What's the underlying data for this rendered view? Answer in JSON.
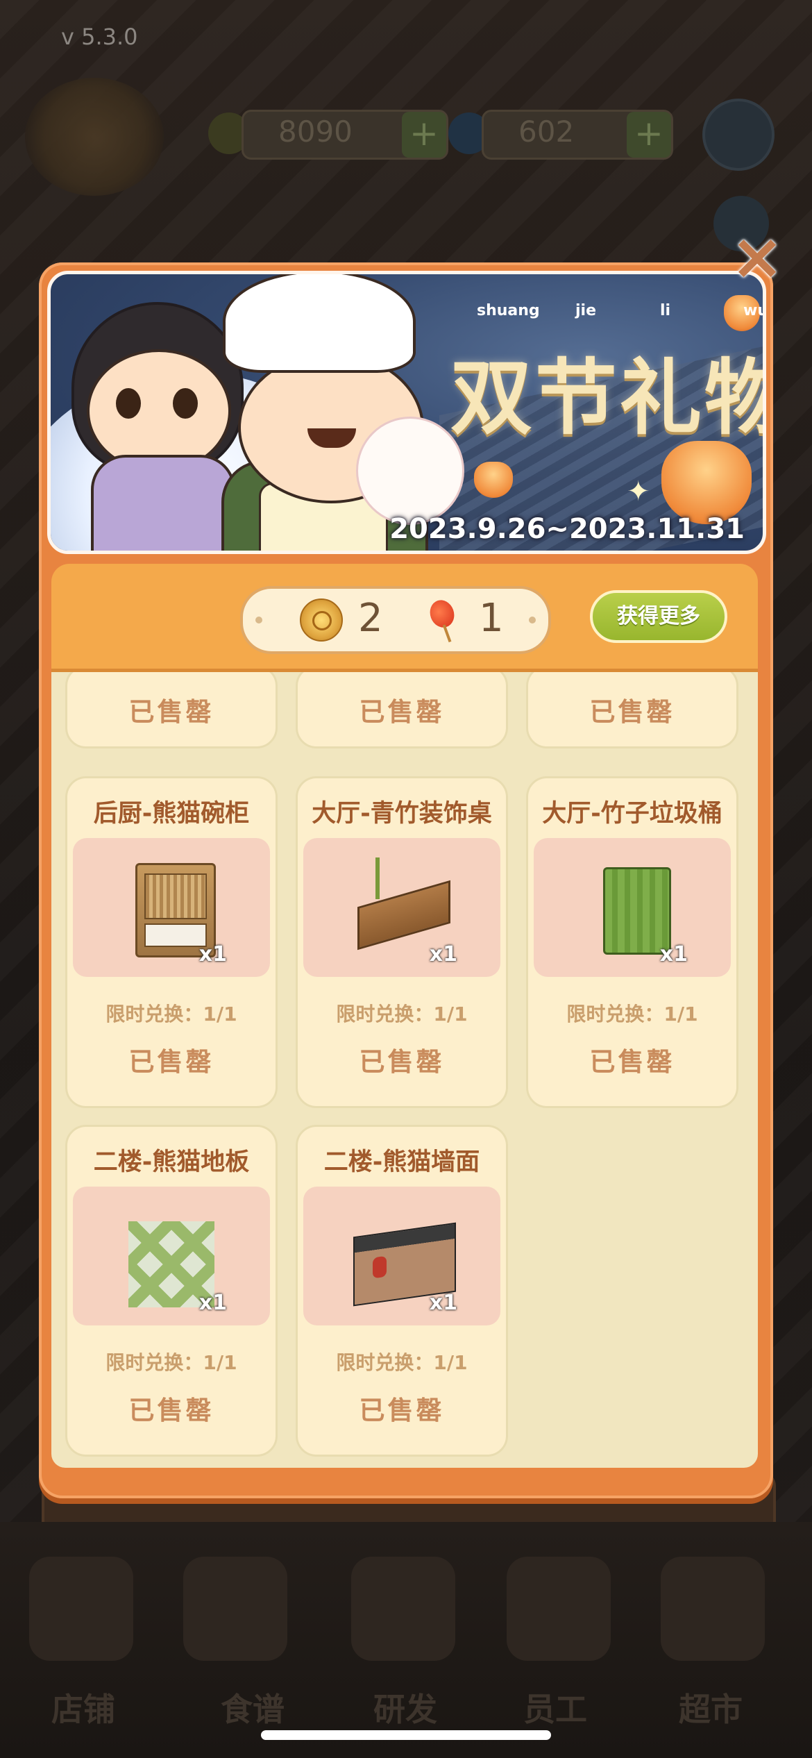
{
  "version": "v 5.3.0",
  "top_bar": {
    "currency_1": "8090",
    "currency_2": "602",
    "plus": "+"
  },
  "bottom_nav": [
    "店铺",
    "食谱",
    "研发",
    "员工",
    "超市"
  ],
  "popup": {
    "close_label": "×",
    "banner": {
      "title": "双节礼物",
      "pinyin": [
        "shuang",
        "jie",
        "li",
        "wu"
      ],
      "date_range": "2023.9.26~2023.11.31"
    },
    "currency": {
      "mooncake_count": "2",
      "lantern_count": "1",
      "get_more_label": "获得更多"
    },
    "top_row_sold": [
      "已售罄",
      "已售罄",
      "已售罄"
    ],
    "items": [
      {
        "title": "后厨-熊猫碗柜",
        "qty": "x1",
        "limit": "限时兑换：1/1",
        "status": "已售罄",
        "art": "cabinet"
      },
      {
        "title": "大厅-青竹装饰桌",
        "qty": "x1",
        "limit": "限时兑换：1/1",
        "status": "已售罄",
        "art": "desk"
      },
      {
        "title": "大厅-竹子垃圾桶",
        "qty": "x1",
        "limit": "限时兑换：1/1",
        "status": "已售罄",
        "art": "bin"
      },
      {
        "title": "二楼-熊猫地板",
        "qty": "x1",
        "limit": "限时兑换：1/1",
        "status": "已售罄",
        "art": "floor"
      },
      {
        "title": "二楼-熊猫墙面",
        "qty": "x1",
        "limit": "限时兑换：1/1",
        "status": "已售罄",
        "art": "wall"
      }
    ]
  }
}
